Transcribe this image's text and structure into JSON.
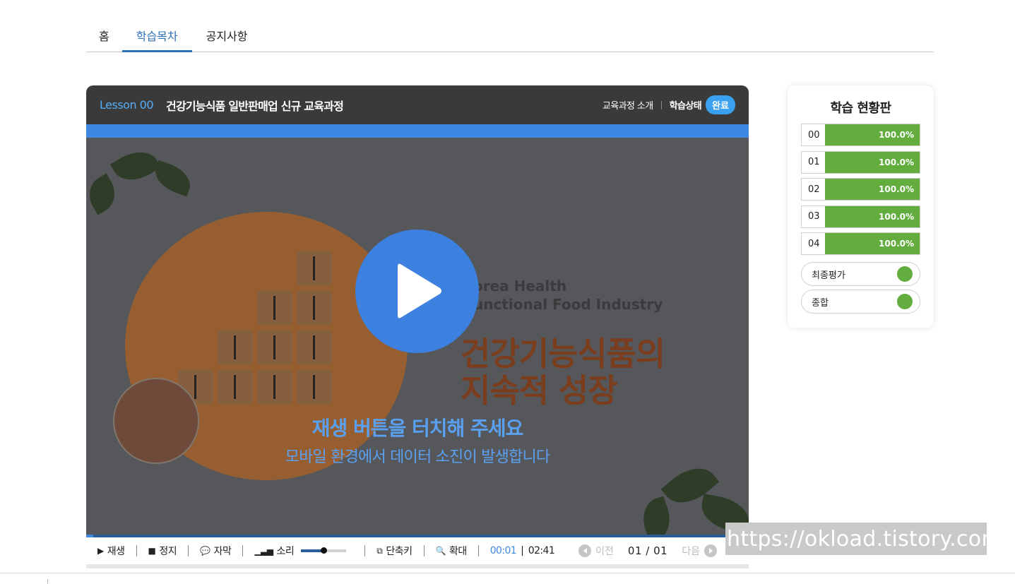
{
  "tabs": [
    {
      "label": "홈",
      "active": false
    },
    {
      "label": "학습목차",
      "active": true
    },
    {
      "label": "공지사항",
      "active": false
    }
  ],
  "player": {
    "lesson_no": "Lesson 00",
    "title": "건강기능식품 일반판매업 신규 교육과정",
    "course_intro_link": "교육과정 소개",
    "status_label": "학습상태",
    "status_badge": "완료",
    "video": {
      "slide_eng_line1": "orea Health",
      "slide_eng_line2": "unctional Food Industry",
      "slide_title_line1": "건강기능식품의",
      "slide_title_line2": "지속적 성장",
      "touch_message": "재생 버튼을 터치해 주세요",
      "data_message": "모바일 환경에서 데이터 소진이 발생합니다",
      "progress_fraction": 0.011
    },
    "controls": {
      "play": "재생",
      "stop": "정지",
      "subtitle": "자막",
      "sound": "소리",
      "volume_fraction": 0.5,
      "shortcut": "단축키",
      "zoom": "확대",
      "time_current": "00:01",
      "time_separator": "|",
      "time_total": "02:41",
      "prev": "이전",
      "page": "01 / 01",
      "next": "다음"
    }
  },
  "board": {
    "title": "학습 현황판",
    "lessons": [
      {
        "no": "00",
        "progress": "100.0%"
      },
      {
        "no": "01",
        "progress": "100.0%"
      },
      {
        "no": "02",
        "progress": "100.0%"
      },
      {
        "no": "03",
        "progress": "100.0%"
      },
      {
        "no": "04",
        "progress": "100.0%"
      }
    ],
    "final_eval": "최종평가",
    "overall": "종합",
    "accent_color": "#62ad3e"
  },
  "watermark": "https://okload.tistory.com"
}
